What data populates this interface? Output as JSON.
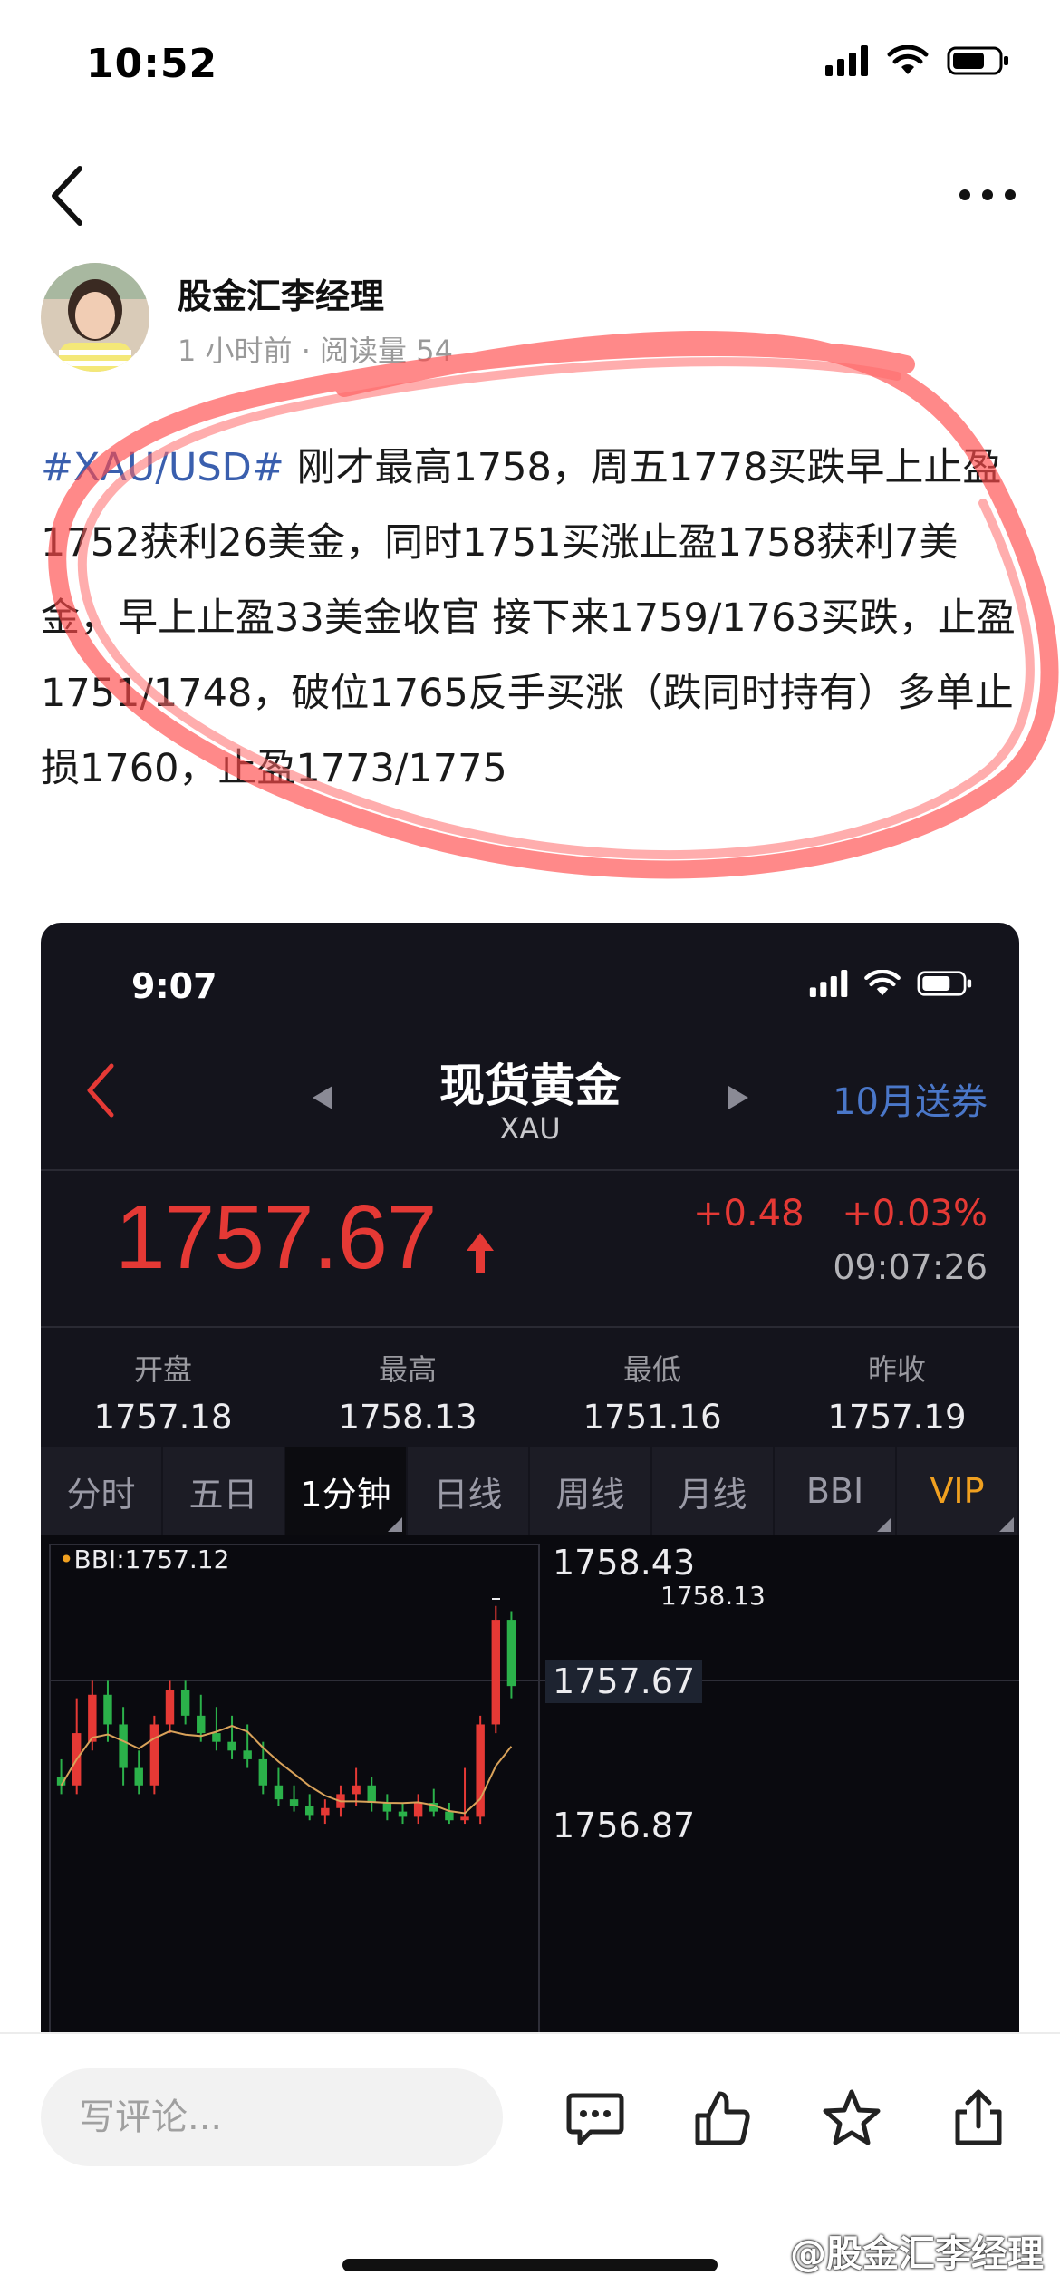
{
  "status_bar": {
    "time": "10:52"
  },
  "author": {
    "name": "股金汇李经理",
    "meta": "1 小时前 · 阅读量 54"
  },
  "post": {
    "hashtag": "#XAU/USD#",
    "body": " 刚才最高1758，周五1778买跌早上止盈1752获利26美金，同时1751买涨止盈1758获利7美金，早上止盈33美金收官 接下来1759/1763买跌，止盈1751/1748，破位1765反手买涨（跌同时持有）多单止损1760，止盈1773/1775"
  },
  "embedded_app": {
    "status_time": "9:07",
    "title": "现货黄金",
    "subtitle": "XAU",
    "promo": "10月送券",
    "price": "1757.67",
    "change": "+0.48",
    "change_pct": "+0.03%",
    "timestamp": "09:07:26",
    "stats": [
      {
        "label": "开盘",
        "value": "1757.18"
      },
      {
        "label": "最高",
        "value": "1758.13"
      },
      {
        "label": "最低",
        "value": "1751.16"
      },
      {
        "label": "昨收",
        "value": "1757.19"
      }
    ],
    "tabs": [
      "分时",
      "五日",
      "1分钟",
      "日线",
      "周线",
      "月线",
      "BBI",
      "VIP"
    ],
    "active_tab": "1分钟",
    "chart": {
      "indicator": "BBI:1757.12",
      "y_labels": [
        "1758.43",
        "1757.67",
        "1756.87"
      ],
      "high_label": "1758.13"
    },
    "colors": {
      "up": "#e53935",
      "down": "#2bb14a",
      "bbi_line": "#d9a25a",
      "accent": "#4a77c9"
    }
  },
  "chart_data": {
    "type": "candlestick",
    "title": "",
    "indicator": "BBI:1757.12",
    "ylim": [
      1756.87,
      1758.43
    ],
    "y_ticks": [
      1758.43,
      1757.67,
      1756.87
    ],
    "annotations": [
      {
        "label": "1758.13",
        "value": 1758.13
      }
    ],
    "current_price": 1757.67,
    "candles": [
      {
        "o": 1757.15,
        "h": 1757.25,
        "l": 1757.05,
        "c": 1757.1
      },
      {
        "o": 1757.1,
        "h": 1757.6,
        "l": 1757.05,
        "c": 1757.4
      },
      {
        "o": 1757.35,
        "h": 1757.7,
        "l": 1757.3,
        "c": 1757.62
      },
      {
        "o": 1757.62,
        "h": 1757.7,
        "l": 1757.35,
        "c": 1757.45
      },
      {
        "o": 1757.45,
        "h": 1757.55,
        "l": 1757.1,
        "c": 1757.2
      },
      {
        "o": 1757.2,
        "h": 1757.3,
        "l": 1757.05,
        "c": 1757.1
      },
      {
        "o": 1757.1,
        "h": 1757.5,
        "l": 1757.05,
        "c": 1757.45
      },
      {
        "o": 1757.45,
        "h": 1757.7,
        "l": 1757.4,
        "c": 1757.65
      },
      {
        "o": 1757.65,
        "h": 1757.7,
        "l": 1757.45,
        "c": 1757.5
      },
      {
        "o": 1757.5,
        "h": 1757.62,
        "l": 1757.35,
        "c": 1757.4
      },
      {
        "o": 1757.4,
        "h": 1757.55,
        "l": 1757.3,
        "c": 1757.35
      },
      {
        "o": 1757.35,
        "h": 1757.5,
        "l": 1757.25,
        "c": 1757.3
      },
      {
        "o": 1757.3,
        "h": 1757.45,
        "l": 1757.2,
        "c": 1757.25
      },
      {
        "o": 1757.25,
        "h": 1757.35,
        "l": 1757.05,
        "c": 1757.1
      },
      {
        "o": 1757.1,
        "h": 1757.2,
        "l": 1756.98,
        "c": 1757.02
      },
      {
        "o": 1757.02,
        "h": 1757.1,
        "l": 1756.95,
        "c": 1756.98
      },
      {
        "o": 1756.98,
        "h": 1757.05,
        "l": 1756.9,
        "c": 1756.93
      },
      {
        "o": 1756.93,
        "h": 1757.02,
        "l": 1756.88,
        "c": 1756.97
      },
      {
        "o": 1756.97,
        "h": 1757.1,
        "l": 1756.92,
        "c": 1757.05
      },
      {
        "o": 1757.05,
        "h": 1757.2,
        "l": 1756.98,
        "c": 1757.1
      },
      {
        "o": 1757.1,
        "h": 1757.15,
        "l": 1756.95,
        "c": 1757.0
      },
      {
        "o": 1757.0,
        "h": 1757.05,
        "l": 1756.9,
        "c": 1756.95
      },
      {
        "o": 1756.95,
        "h": 1757.0,
        "l": 1756.88,
        "c": 1756.92
      },
      {
        "o": 1756.92,
        "h": 1757.05,
        "l": 1756.88,
        "c": 1757.0
      },
      {
        "o": 1757.0,
        "h": 1757.08,
        "l": 1756.92,
        "c": 1756.95
      },
      {
        "o": 1756.95,
        "h": 1757.0,
        "l": 1756.88,
        "c": 1756.9
      },
      {
        "o": 1756.9,
        "h": 1757.2,
        "l": 1756.88,
        "c": 1756.92
      },
      {
        "o": 1756.92,
        "h": 1757.5,
        "l": 1756.88,
        "c": 1757.45
      },
      {
        "o": 1757.45,
        "h": 1758.13,
        "l": 1757.4,
        "c": 1758.05
      },
      {
        "o": 1758.05,
        "h": 1758.1,
        "l": 1757.6,
        "c": 1757.67
      }
    ]
  },
  "bottom_bar": {
    "comment_placeholder": "写评论...",
    "icons": [
      "comment-icon",
      "like-icon",
      "favorite-icon",
      "share-icon"
    ],
    "watermark": "@股金汇李经理"
  }
}
